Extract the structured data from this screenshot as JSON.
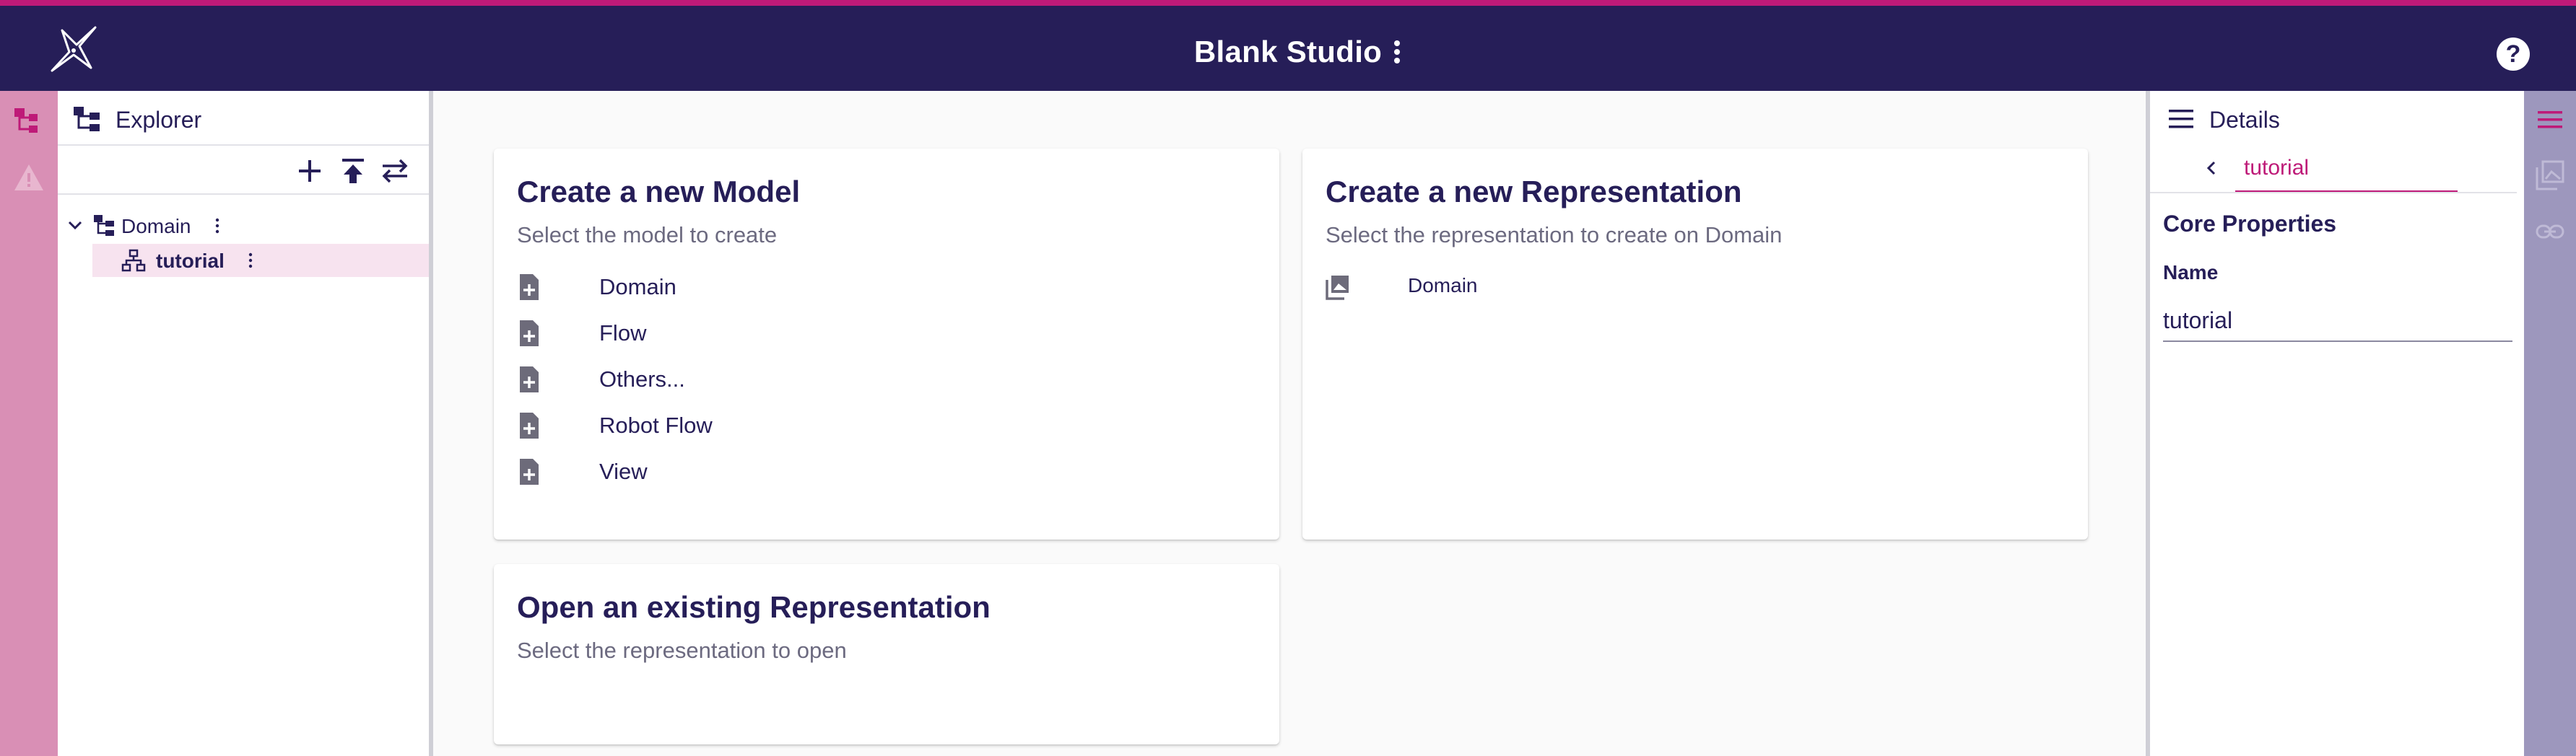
{
  "app": {
    "title": "Blank Studio",
    "colors": {
      "primary": "#261e58",
      "accent": "#be1a78",
      "left_rail": "#d98fb5",
      "right_rail": "#9d97bd"
    }
  },
  "header": {
    "help_label": "?"
  },
  "left_rail": {
    "items": [
      {
        "icon": "explorer-tree-icon"
      },
      {
        "icon": "warning-icon"
      }
    ]
  },
  "explorer": {
    "title": "Explorer",
    "toolbar": [
      {
        "icon": "add-icon"
      },
      {
        "icon": "upload-icon"
      },
      {
        "icon": "swap-icon"
      }
    ],
    "tree": [
      {
        "label": "Domain",
        "icon": "domain-tree-icon",
        "expanded": true
      },
      {
        "label": "tutorial",
        "icon": "hierarchy-icon",
        "selected": true
      }
    ]
  },
  "main": {
    "new_model": {
      "title": "Create a new Model",
      "subtitle": "Select the model to create",
      "items": [
        "Domain",
        "Flow",
        "Others...",
        "Robot Flow",
        "View"
      ]
    },
    "new_representation": {
      "title": "Create a new Representation",
      "subtitle": "Select the representation to create on Domain",
      "items": [
        "Domain"
      ]
    },
    "open_representation": {
      "title": "Open an existing Representation",
      "subtitle": "Select the representation to open"
    }
  },
  "details": {
    "title": "Details",
    "tab": "tutorial",
    "section": "Core Properties",
    "field_label": "Name",
    "field_value": "tutorial"
  },
  "right_rail": {
    "items": [
      {
        "icon": "menu-icon"
      },
      {
        "icon": "image-icon"
      },
      {
        "icon": "link-icon"
      }
    ]
  }
}
